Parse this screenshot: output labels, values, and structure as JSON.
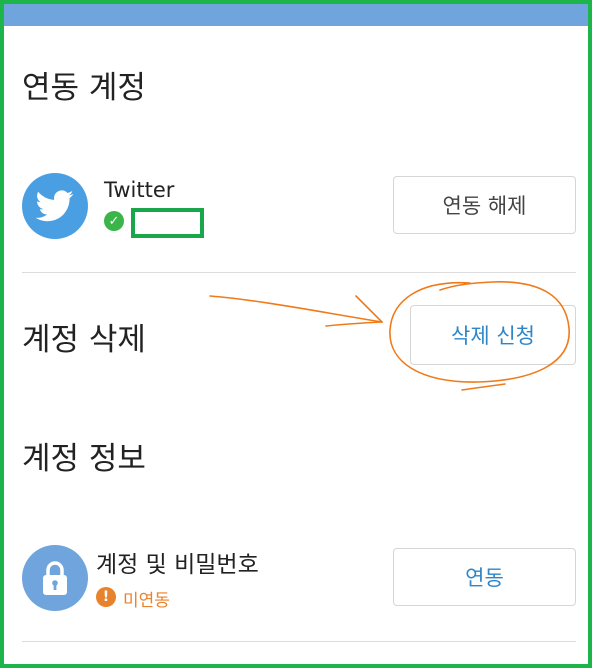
{
  "sections": {
    "linked_accounts": {
      "title": "연동 계정",
      "twitter": {
        "label": "Twitter",
        "status_icon": "check-circle-icon",
        "button_label": "연동 해제"
      }
    },
    "delete_account": {
      "title": "계정 삭제",
      "button_label": "삭제 신청"
    },
    "account_info": {
      "title": "계정 정보",
      "credentials": {
        "label": "계정 및 비밀번호",
        "status_icon": "exclamation-circle-icon",
        "status_text": "미연동",
        "button_label": "연동"
      }
    }
  },
  "colors": {
    "topbar": "#6fa5dc",
    "twitter_blue": "#4a9fe3",
    "link_blue": "#2e86c9",
    "ok_green": "#3bb54a",
    "warn_orange": "#e8832d",
    "annotation_orange": "#f07a1a",
    "frame_green": "#1db54a"
  }
}
